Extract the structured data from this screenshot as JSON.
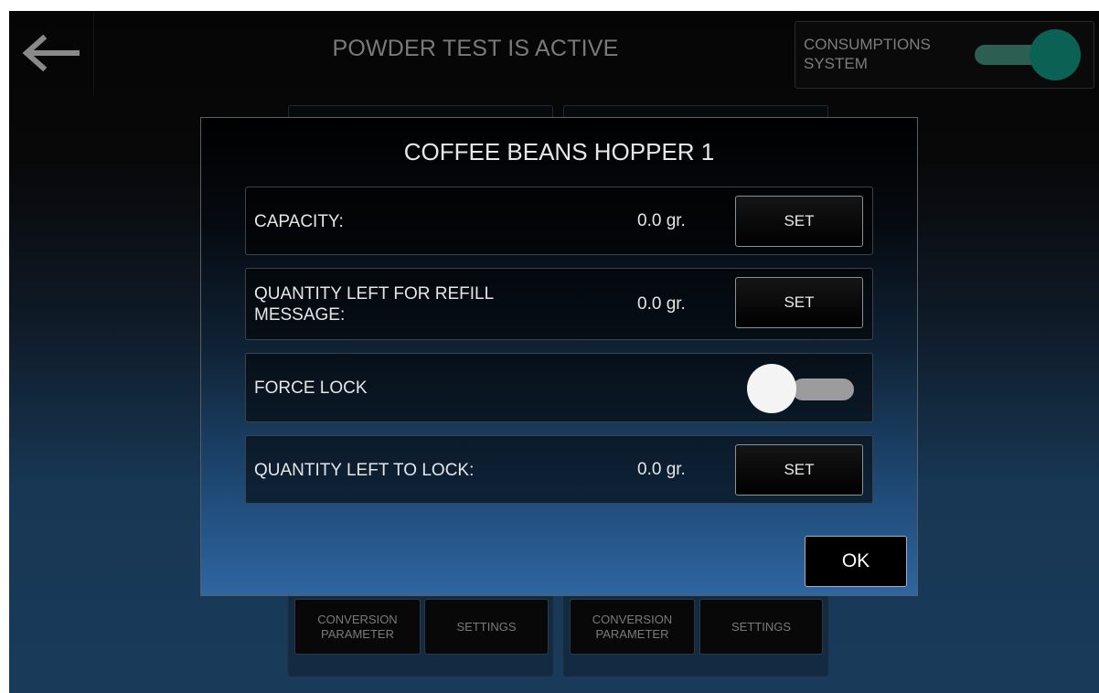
{
  "header": {
    "title": "POWDER TEST IS ACTIVE",
    "back_icon": "arrow-left-icon",
    "consumption_label_line1": "CONSUMPTIONS",
    "consumption_label_line2": "SYSTEM",
    "consumption_toggle_on": true,
    "toggle_color": "#0c6155"
  },
  "background_tiles": [
    {
      "conversion_label_line1": "CONVERSION",
      "conversion_label_line2": "PARAMETER",
      "settings_label": "SETTINGS"
    },
    {
      "conversion_label_line1": "CONVERSION",
      "conversion_label_line2": "PARAMETER",
      "settings_label": "SETTINGS"
    }
  ],
  "modal": {
    "title": "COFFEE BEANS HOPPER 1",
    "rows": [
      {
        "label": "CAPACITY:",
        "value": "0.0 gr.",
        "button": "SET"
      },
      {
        "label_line1": "QUANTITY LEFT FOR REFILL",
        "label_line2": "MESSAGE:",
        "value": "0.0 gr.",
        "button": "SET"
      },
      {
        "label": "FORCE LOCK",
        "toggle_on": false
      },
      {
        "label": "QUANTITY LEFT TO LOCK:",
        "value": "0.0 gr.",
        "button": "SET"
      }
    ],
    "ok_label": "OK"
  }
}
